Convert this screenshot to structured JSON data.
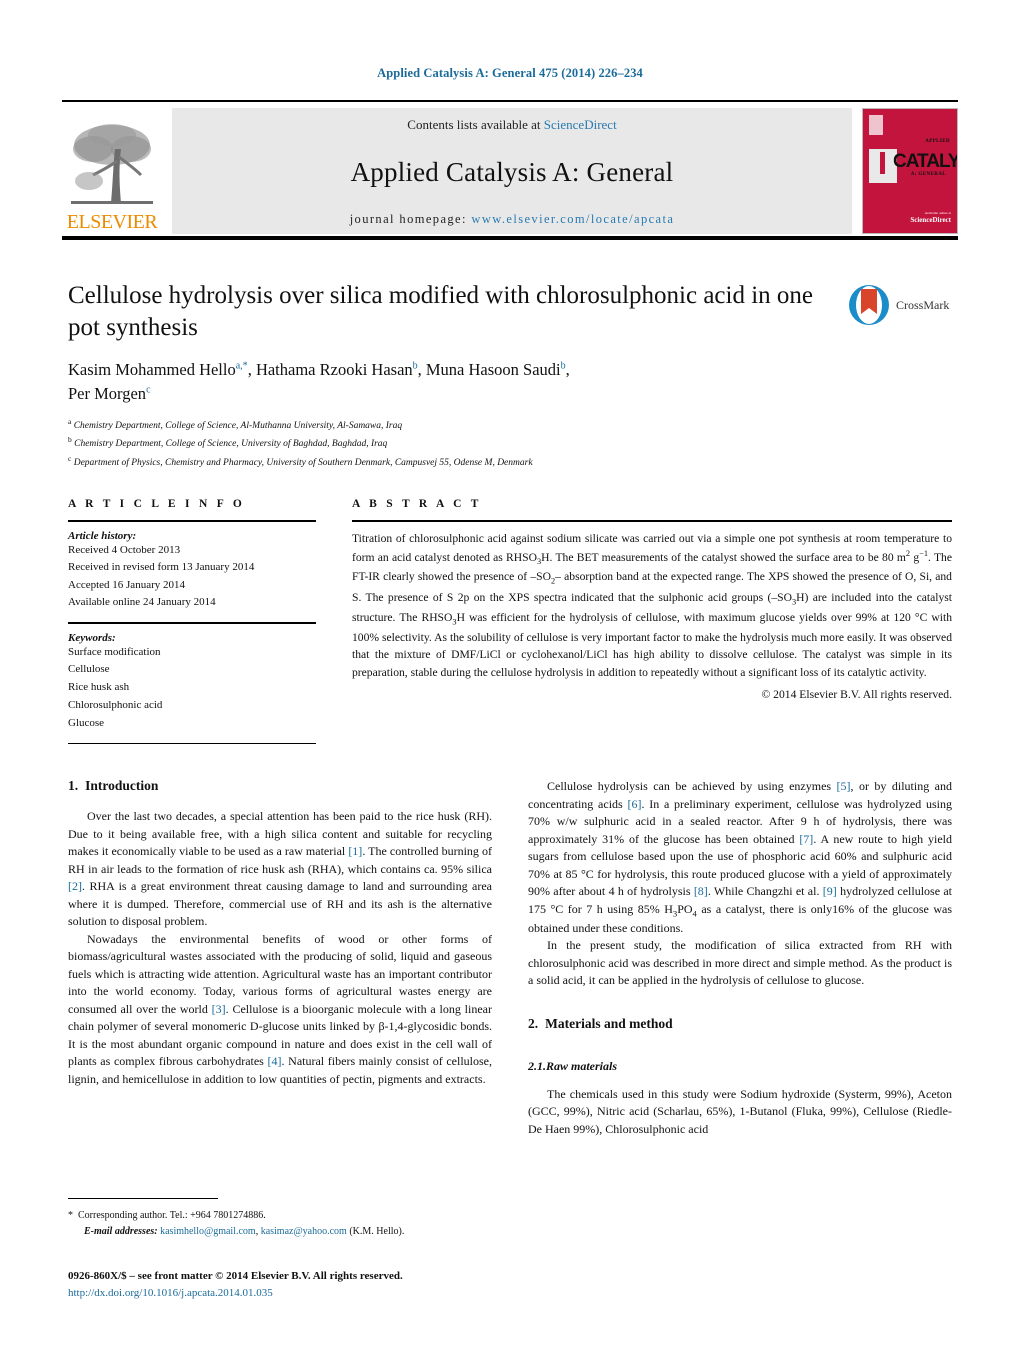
{
  "running_head": "Applied Catalysis A: General 475 (2014) 226–234",
  "masthead": {
    "contents_prefix": "Contents lists available at ",
    "sciencedirect": "ScienceDirect",
    "journal_title": "Applied Catalysis A: General",
    "homepage_label": "journal homepage:",
    "homepage_url": "www.elsevier.com/locate/apcata",
    "publisher_logo_text": "ELSEVIER",
    "cover": {
      "title": "CATALYSIS",
      "sub_top": "APPLIED",
      "sub_bottom": "A: GENERAL",
      "available_online": "Available online at",
      "sciencedirect": "ScienceDirect"
    }
  },
  "article": {
    "title": "Cellulose hydrolysis over silica modified with chlorosulphonic acid in one pot synthesis",
    "crossmark_label": "CrossMark",
    "authors_line_1": "Kasim Mohammed Hello",
    "authors_mark_1": "a,*",
    "authors_line_2": ", Hathama Rzooki Hasan",
    "authors_mark_2": "b",
    "authors_line_3": ", Muna Hasoon Saudi",
    "authors_mark_3": "b",
    "authors_line_4": ",",
    "authors_line_5": "Per Morgen",
    "authors_mark_5": "c",
    "affiliations": [
      {
        "mark": "a",
        "text": "Chemistry Department, College of Science, Al-Muthanna University, Al-Samawa, Iraq"
      },
      {
        "mark": "b",
        "text": "Chemistry Department, College of Science, University of Baghdad, Baghdad, Iraq"
      },
      {
        "mark": "c",
        "text": "Department of Physics, Chemistry and Pharmacy, University of Southern Denmark, Campusvej 55, Odense M, Denmark"
      }
    ]
  },
  "article_info": {
    "heading": "A R T I C L E    I N F O",
    "history_label": "Article history:",
    "history": [
      "Received 4 October 2013",
      "Received in revised form 13 January 2014",
      "Accepted 16 January 2014",
      "Available online 24 January 2014"
    ],
    "keywords_label": "Keywords:",
    "keywords": [
      "Surface modification",
      "Cellulose",
      "Rice husk ash",
      "Chlorosulphonic acid",
      "Glucose"
    ]
  },
  "abstract": {
    "heading": "A B S T R A C T",
    "text_part_1": "Titration of chlorosulphonic acid against sodium silicate was carried out via a simple one pot synthesis at room temperature to form an acid catalyst denoted as RHSO",
    "text_part_2": "H. The BET measurements of the catalyst showed the surface area to be 80 m",
    "text_part_3": "g",
    "text_part_4": ". The FT-IR clearly showed the presence of –SO",
    "text_part_5": "– absorption band at the expected range. The XPS showed the presence of O, Si, and S. The presence of S 2p on the XPS spectra indicated that the sulphonic acid groups (–SO",
    "text_part_6": "H) are included into the catalyst structure. The RHSO",
    "text_part_7": "H was efficient for the hydrolysis of cellulose, with maximum glucose yields over 99% at 120 °C with 100% selectivity. As the solubility of cellulose is very important factor to make the hydrolysis much more easily. It was observed that the mixture of DMF/LiCl or cyclohexanol/LiCl has high ability to dissolve cellulose. The catalyst was simple in its preparation, stable during the cellulose hydrolysis in addition to repeatedly without a significant loss of its catalytic activity.",
    "copyright": "© 2014 Elsevier B.V. All rights reserved."
  },
  "sections": {
    "introduction_num": "1.",
    "introduction_title": "Introduction",
    "materials_num": "2.",
    "materials_title": "Materials and method",
    "raw_materials_num": "2.1.",
    "raw_materials_title": "Raw materials"
  },
  "body": {
    "p1_a": "Over the last two decades, a special attention has been paid to the rice husk (RH). Due to it being available free, with a high silica content and suitable for recycling makes it economically viable to be used as a raw material ",
    "p1_ref1": "[1]",
    "p1_b": ". The controlled burning of RH in air leads to the formation of rice husk ash (RHA), which contains ca. 95% silica ",
    "p1_ref2": "[2]",
    "p1_c": ". RHA is a great environment threat causing damage to land and surrounding area where it is dumped. Therefore, commercial use of RH and its ash is the alternative solution to disposal problem.",
    "p2_a": "Nowadays the environmental benefits of wood or other forms of biomass/agricultural wastes associated with the producing of solid, liquid and gaseous fuels which is attracting wide attention. Agricultural waste has an important contributor into the world economy. Today, various forms of agricultural wastes energy are consumed all over the world ",
    "p2_ref3": "[3]",
    "p2_b": ". Cellulose is a bioorganic molecule with a long linear chain polymer of several monomeric D-glucose units linked by β-1,4-glycosidic bonds. It is the most abundant organic compound in nature and does exist in the cell wall of plants as complex fibrous carbohydrates ",
    "p2_ref4": "[4]",
    "p2_c": ". Natural fibers mainly consist of cellulose, lignin, and hemicellulose in addition to low quantities of pectin, pigments and extracts.",
    "p3_a": "Cellulose hydrolysis can be achieved by using enzymes ",
    "p3_ref5": "[5]",
    "p3_b": ", or by diluting and concentrating acids ",
    "p3_ref6": "[6]",
    "p3_c": ". In a preliminary experiment, cellulose was hydrolyzed using 70% w/w sulphuric acid in a sealed reactor. After 9 h of hydrolysis, there was approximately 31% of the glucose has been obtained ",
    "p3_ref7": "[7]",
    "p3_d": ". A new route to high yield sugars from cellulose based upon the use of phosphoric acid 60% and sulphuric acid 70% at 85 °C for hydrolysis, this route produced glucose with a yield of approximately 90% after about 4 h of hydrolysis ",
    "p3_ref8": "[8]",
    "p3_e": ". While Changzhi et al. ",
    "p3_ref9": "[9]",
    "p3_f": " hydrolyzed cellulose at 175 °C for 7 h using 85% H",
    "p3_g": "PO",
    "p3_h": " as a catalyst, there is only16% of the glucose was obtained under these conditions.",
    "p4": "In the present study, the modification of silica extracted from RH with chlorosulphonic acid was described in more direct and simple method. As the product is a solid acid, it can be applied in the hydrolysis of cellulose to glucose.",
    "p5": "The chemicals used in this study were Sodium hydroxide (Systerm, 99%), Aceton (GCC, 99%), Nitric acid (Scharlau, 65%), 1-Butanol (Fluka, 99%), Cellulose (Riedle-De Haen 99%), Chlorosulphonic acid"
  },
  "footnote": {
    "corresponding": "Corresponding author. Tel.: +964 7801274886.",
    "email_label": "E-mail addresses:",
    "email_1": "kasimhello@gmail.com",
    "email_sep": ", ",
    "email_2": "kasimaz@yahoo.com",
    "email_tail": " (K.M. Hello).",
    "issn": "0926-860X/$ – see front matter © 2014 Elsevier B.V. All rights reserved.",
    "doi": "http://dx.doi.org/10.1016/j.apcata.2014.01.035"
  }
}
